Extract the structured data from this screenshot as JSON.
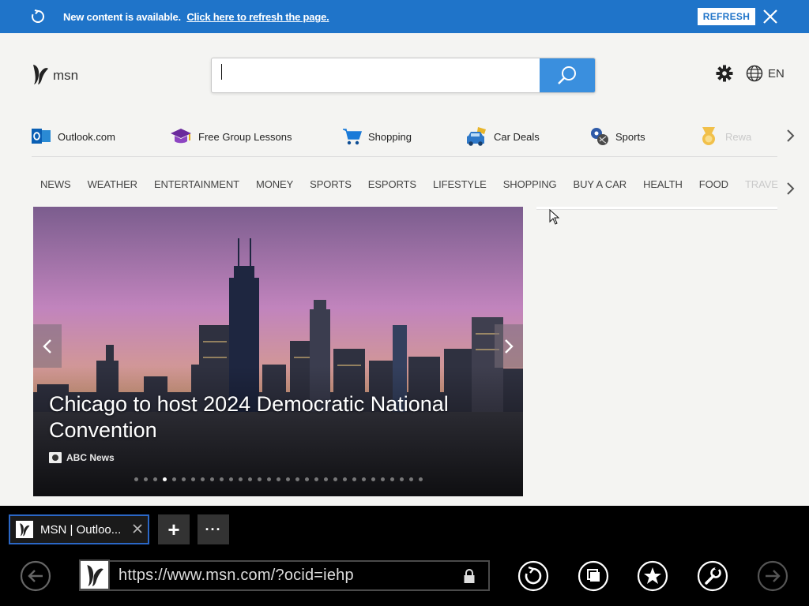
{
  "notification": {
    "message": "New content is available.",
    "link": "Click here to refresh the page.",
    "refresh_button": "REFRESH"
  },
  "header": {
    "brand": "msn",
    "search_value": "",
    "language": "EN"
  },
  "quick_links": [
    {
      "label": "Outlook.com",
      "icon": "outlook-icon"
    },
    {
      "label": "Free Group Lessons",
      "icon": "graduation-cap-icon"
    },
    {
      "label": "Shopping",
      "icon": "shopping-cart-icon"
    },
    {
      "label": "Car Deals",
      "icon": "car-icon"
    },
    {
      "label": "Sports",
      "icon": "sports-ball-icon"
    },
    {
      "label": "Rewa",
      "icon": "rewards-medal-icon"
    }
  ],
  "categories": [
    "NEWS",
    "WEATHER",
    "ENTERTAINMENT",
    "MONEY",
    "SPORTS",
    "ESPORTS",
    "LIFESTYLE",
    "SHOPPING",
    "BUY A CAR",
    "HEALTH",
    "FOOD",
    "TRAVE"
  ],
  "hero": {
    "headline": "Chicago to host 2024 Democratic National Convention",
    "source": "ABC News",
    "slide_count": 31,
    "active_slide": 4
  },
  "browser": {
    "tab_title": "MSN | Outloo...",
    "new_tab": "+",
    "more_tabs": "···",
    "url": "https://www.msn.com/?ocid=iehp"
  },
  "colors": {
    "notification_bar": "#1f74c9",
    "search_button": "#3a8fde",
    "chrome_background": "#000000",
    "tab_border": "#2b67c6"
  }
}
